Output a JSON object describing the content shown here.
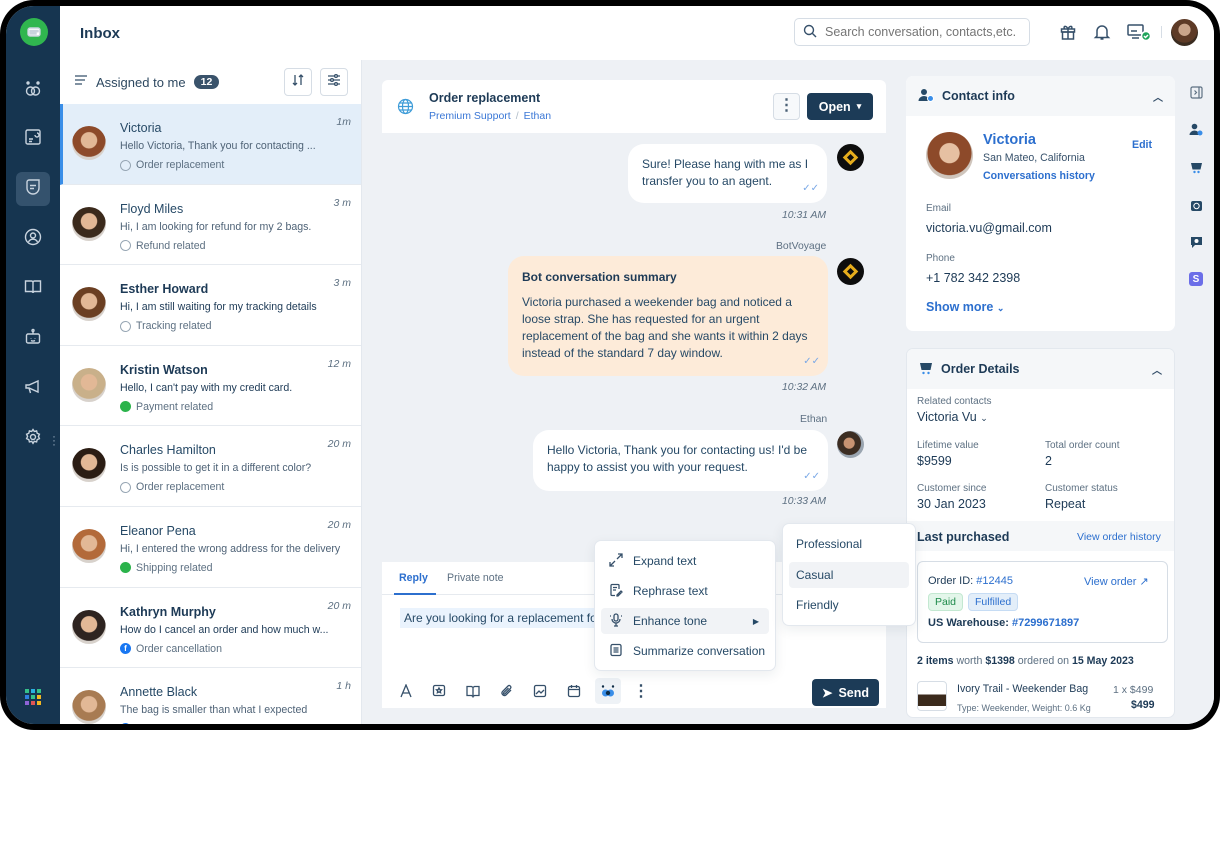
{
  "app": {
    "title": "Inbox"
  },
  "topbar": {
    "search_placeholder": "Search conversation, contacts,etc.",
    "icons": [
      "gift-icon",
      "bell-icon",
      "desktop-status-icon",
      "user-avatar"
    ]
  },
  "rail": {
    "items": [
      "logo",
      "analytics-icon",
      "dashboard-icon",
      "conversations-icon",
      "contacts-icon",
      "knowledge-base-icon",
      "bot-icon",
      "campaigns-icon",
      "settings-icon",
      "apps-grid-icon"
    ],
    "active": "conversations-icon"
  },
  "list": {
    "filter_label": "Assigned to me",
    "count": "12",
    "conversations": [
      {
        "name": "Victoria",
        "preview": "Hello Victoria, Thank you for contacting ...",
        "tag": "Order replacement",
        "channel": "web",
        "time": "1m",
        "bold": false,
        "selected": true
      },
      {
        "name": "Floyd Miles",
        "preview": "Hi, I am looking for refund for my 2 bags.",
        "tag": "Refund related",
        "channel": "web",
        "time": "3 m",
        "bold": false
      },
      {
        "name": "Esther Howard",
        "preview": "Hi, I am still waiting for my tracking details",
        "tag": "Tracking related",
        "channel": "web",
        "time": "3 m",
        "bold": true
      },
      {
        "name": "Kristin Watson",
        "preview": "Hello, I can't pay with my credit card.",
        "tag": "Payment related",
        "channel": "whatsapp",
        "time": "12 m",
        "bold": true
      },
      {
        "name": "Charles Hamilton",
        "preview": "Is is possible to get it in a different color?",
        "tag": "Order replacement",
        "channel": "web",
        "time": "20 m",
        "bold": false
      },
      {
        "name": "Eleanor Pena",
        "preview": "Hi, I entered the wrong address for the delivery",
        "tag": "Shipping related",
        "channel": "whatsapp",
        "time": "20 m",
        "bold": false
      },
      {
        "name": "Kathryn Murphy",
        "preview": "How do I cancel an order and how much w...",
        "tag": "Order cancellation",
        "channel": "facebook",
        "time": "20 m",
        "bold": true
      },
      {
        "name": "Annette Black",
        "preview": "The bag is smaller than what I expected",
        "tag": "",
        "channel": "facebook",
        "time": "1 h",
        "bold": false
      }
    ]
  },
  "chat": {
    "title": "Order replacement",
    "group": "Premium Support",
    "agent": "Ethan",
    "status_button": "Open",
    "messages": [
      {
        "sender": "",
        "text": "Sure! Please hang with me as I transfer you to an agent.",
        "time": "10:31 AM"
      },
      {
        "sender": "BotVoyage",
        "title": "Bot conversation summary",
        "text": "Victoria purchased a weekender bag and noticed a loose strap. She has requested for an urgent replacement of the bag and she wants it within 2 days instead of the standard 7 day window.",
        "time": "10:32 AM"
      },
      {
        "sender": "Ethan",
        "text": "Hello Victoria, Thank you for contacting us! I'd be happy to assist you with your request.",
        "time": "10:33 AM"
      }
    ]
  },
  "composer": {
    "tabs": [
      "Reply",
      "Private note"
    ],
    "active_tab": "Reply",
    "draft": "Are you looking for a replacement for your bag?",
    "send_label": "Send",
    "tools": [
      "text-format-icon",
      "canned-response-icon",
      "knowledge-base-icon",
      "attachment-icon",
      "image-icon",
      "calendar-icon",
      "ai-assist-icon",
      "more-icon"
    ]
  },
  "ai_menu": {
    "items": [
      "Expand text",
      "Rephrase text",
      "Enhance tone",
      "Summarize conversation"
    ],
    "highlighted": "Enhance tone"
  },
  "tone_menu": {
    "items": [
      "Professional",
      "Casual",
      "Friendly"
    ],
    "highlighted": "Casual"
  },
  "contact": {
    "header": "Contact info",
    "name": "Victoria",
    "location": "San Mateo, California",
    "history_link": "Conversations history",
    "edit": "Edit",
    "email_label": "Email",
    "email": "victoria.vu@gmail.com",
    "phone_label": "Phone",
    "phone": "+1 782 342 2398",
    "show_more": "Show more"
  },
  "orders": {
    "header": "Order Details",
    "related_label": "Related contacts",
    "related_value": "Victoria Vu",
    "lifetime_label": "Lifetime value",
    "lifetime_value": "$9599",
    "count_label": "Total order count",
    "count_value": "2",
    "since_label": "Customer since",
    "since_value": "30 Jan 2023",
    "status_label": "Customer status",
    "status_value": "Repeat",
    "last_purchased": "Last purchased",
    "view_history": "View order history",
    "order_id_label": "Order ID:",
    "order_id": "#12445",
    "view_order": "View order",
    "pill_paid": "Paid",
    "pill_fulfilled": "Fulfilled",
    "warehouse_label": "US Warehouse:",
    "warehouse_id": "#7299671897",
    "summary_items": "2 items",
    "summary_worth": "worth",
    "summary_amount": "$1398",
    "summary_on": "ordered on",
    "summary_date": "15 May 2023",
    "item_name": "Ivory Trail - Weekender Bag",
    "item_meta": "Type: Weekender, Weight: 0.6 Kg",
    "item_qty": "1 x $499",
    "item_total": "$499"
  },
  "right_strip": [
    "collapse-panel-icon",
    "contact-info-icon",
    "cart-icon",
    "timer-icon",
    "bot-chat-icon",
    "shopify-s-icon"
  ]
}
